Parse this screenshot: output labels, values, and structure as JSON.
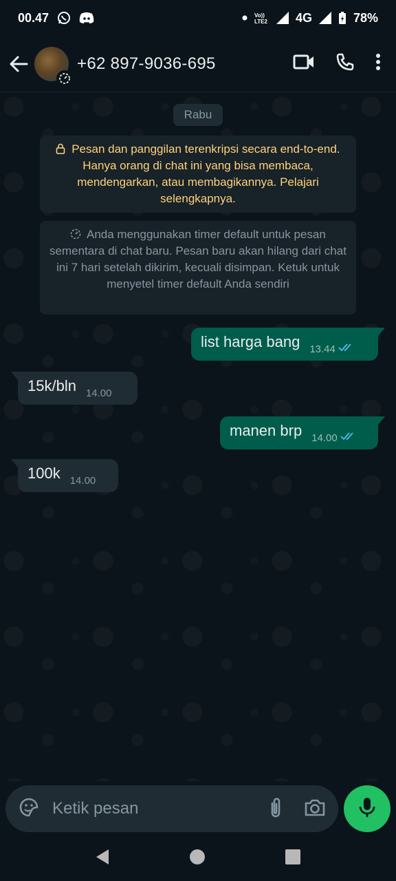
{
  "status_bar": {
    "time": "00.47",
    "network": "4G",
    "battery": "78%"
  },
  "header": {
    "contact": "+62 897-9036-695",
    "icons": [
      "back-arrow-icon",
      "video-call-icon",
      "voice-call-icon",
      "more-vert-icon"
    ]
  },
  "chat": {
    "date_chip": "Rabu",
    "encryption_notice": "Pesan dan panggilan terenkripsi secara end-to-end. Hanya orang di chat ini yang bisa membaca, mendengarkan, atau membagikannya. Pelajari selengkapnya.",
    "timer_notice": "Anda menggunakan timer default untuk pesan sementara di chat baru. Pesan baru akan hilang dari chat ini 7 hari setelah dikirim, kecuali disimpan. Ketuk untuk menyetel timer default Anda sendiri",
    "messages": [
      {
        "direction": "out",
        "text": "list harga bang",
        "time": "13.44",
        "status": "read"
      },
      {
        "direction": "in",
        "text": "15k/bln",
        "time": "14.00"
      },
      {
        "direction": "out",
        "text": "manen brp",
        "time": "14.00",
        "status": "read"
      },
      {
        "direction": "in",
        "text": "100k",
        "time": "14.00"
      }
    ]
  },
  "composer": {
    "placeholder": "Ketik pesan"
  },
  "colors": {
    "background": "#0b141a",
    "outgoing_bubble": "#005c4b",
    "incoming_bubble": "#202c33",
    "accent_green": "#21c063",
    "read_tick": "#53bdeb",
    "notice_yellow": "#ffd279"
  }
}
